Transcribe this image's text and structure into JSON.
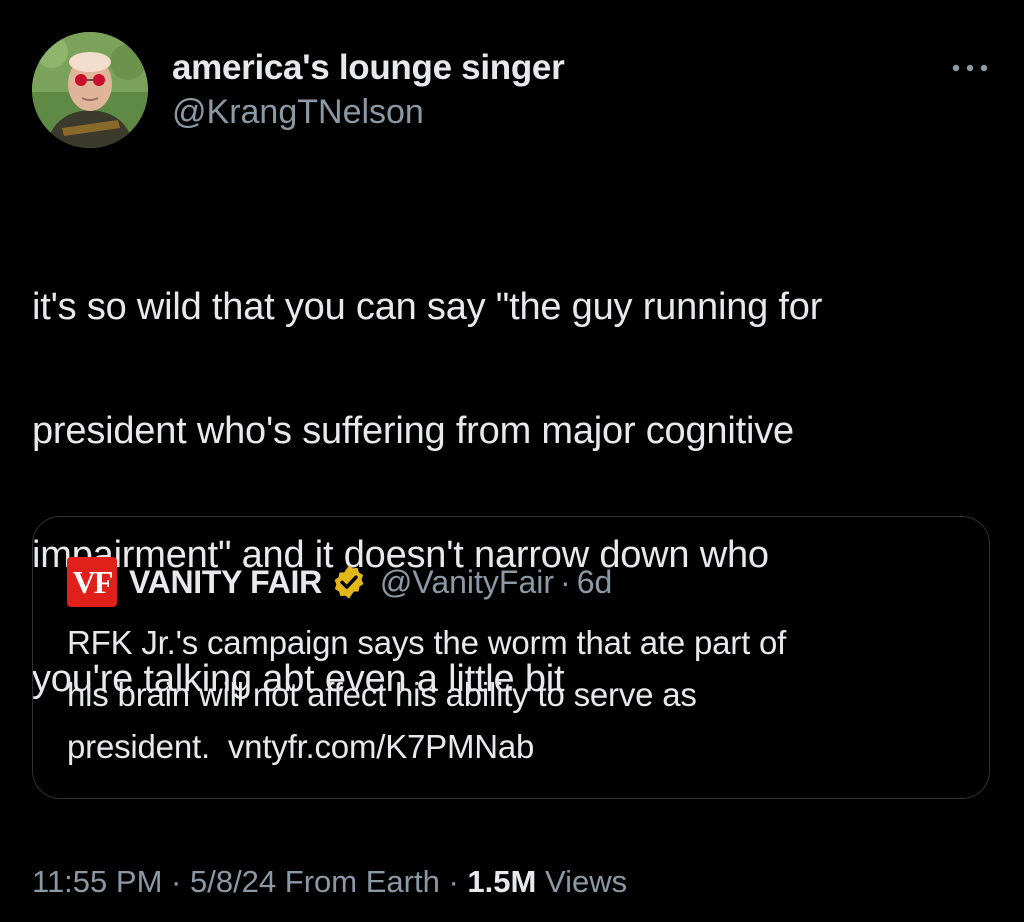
{
  "author": {
    "display_name": "america's lounge singer",
    "handle": "@KrangTNelson",
    "avatar_icon": "profile-photo"
  },
  "more_icon": "ellipsis-icon",
  "tweet": {
    "text_lines": [
      "it's so wild that you can say \"the guy running for",
      "president who's suffering from major cognitive",
      "impairment\" and it doesn't narrow down who",
      "you're talking abt even a little bit"
    ]
  },
  "quote": {
    "logo_text": "VF",
    "name": "VANITY FAIR",
    "verified_icon": "gold-verified-badge-icon",
    "handle": "@VanityFair",
    "dot": "·",
    "time": "6d",
    "text_lines": [
      "RFK Jr.'s campaign says the worm that ate part of",
      "his brain will not affect his ability to serve as",
      "president."
    ],
    "link": "vntyfr.com/K7PMNab"
  },
  "meta": {
    "time": "11:55 PM",
    "sep1": "·",
    "date": "5/8/24",
    "source": "From Earth",
    "sep2": "·",
    "views_count": "1.5M",
    "views_label": "Views"
  },
  "colors": {
    "background": "#000000",
    "primary_text": "#e7e9ea",
    "secondary_text": "#8b98a5",
    "border": "#2f3336",
    "vf_red": "#e0201b",
    "verified_gold": "#e2b719"
  }
}
